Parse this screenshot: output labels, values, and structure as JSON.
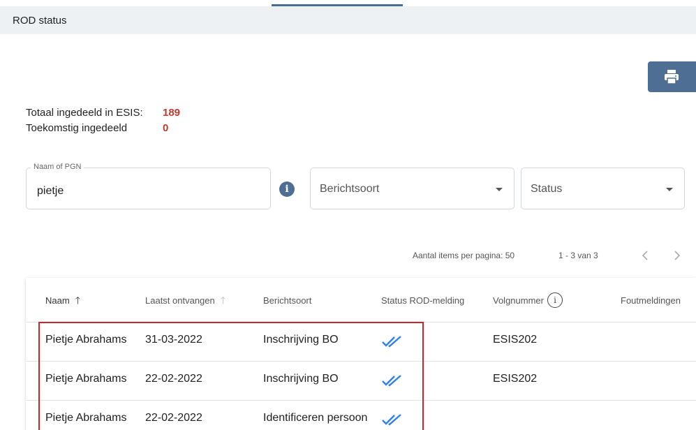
{
  "header": {
    "title": "ROD status"
  },
  "summary": {
    "total_label": "Totaal ingedeeld in ESIS:",
    "total_value": "189",
    "future_label": "Toekomstig ingedeeld",
    "future_value": "0"
  },
  "filters": {
    "naam_label": "Naam of PGN",
    "naam_value": "pietje",
    "berichtsoort_placeholder": "Berichtsoort",
    "status_placeholder": "Status"
  },
  "paginator": {
    "per_page_label": "Aantal items per pagina: 50",
    "range": "1 - 3 van 3"
  },
  "table": {
    "headers": {
      "naam": "Naam",
      "laatst": "Laatst ontvangen",
      "berichtsoort": "Berichtsoort",
      "status": "Status ROD-melding",
      "volgnummer": "Volgnummer",
      "foutmeldingen": "Foutmeldingen"
    },
    "rows": [
      {
        "naam": "Pietje Abrahams",
        "laatst": "31-03-2022",
        "berichtsoort": "Inschrijving BO",
        "status": "double-check-icon",
        "volgnummer": "ESIS202",
        "foutmeldingen": ""
      },
      {
        "naam": "Pietje Abrahams",
        "laatst": "22-02-2022",
        "berichtsoort": "Inschrijving BO",
        "status": "double-check-icon",
        "volgnummer": "ESIS202",
        "foutmeldingen": ""
      },
      {
        "naam": "Pietje Abrahams",
        "laatst": "22-02-2022",
        "berichtsoort": "Identificeren persoon",
        "status": "double-check-icon",
        "volgnummer": "",
        "foutmeldingen": ""
      }
    ]
  },
  "colors": {
    "accent": "#4e6f93",
    "highlight": "#c9262c",
    "value_red": "#c0392b",
    "check_blue": "#2f80ed"
  },
  "icons": {
    "print": "printer-icon",
    "info": "info-icon",
    "sort": "arrow-up-icon",
    "status": "double-check-icon"
  }
}
